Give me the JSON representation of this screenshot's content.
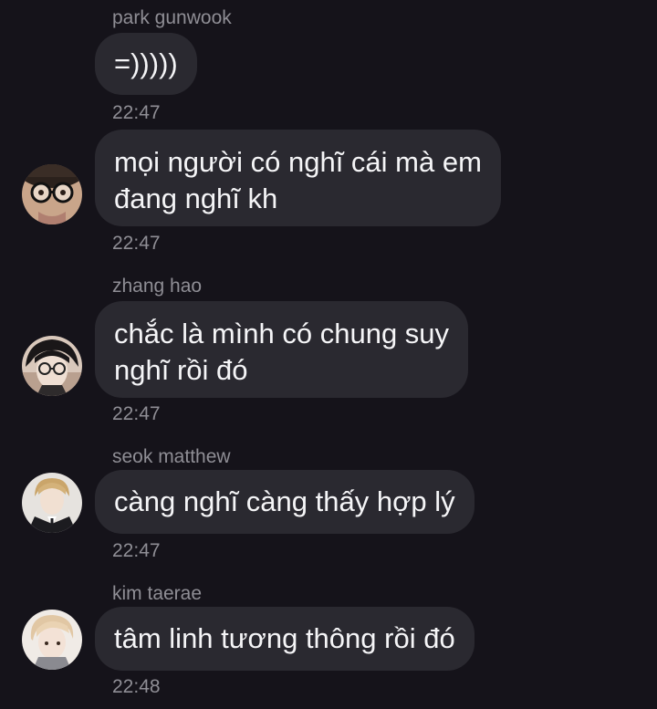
{
  "messages": [
    {
      "sender": "park gunwook",
      "lines": [
        "=)))))"
      ],
      "time": "22:47",
      "avatar": null
    },
    {
      "sender": "",
      "lines": [
        "mọi người có nghĩ cái mà em",
        "đang nghĩ kh"
      ],
      "time": "22:47",
      "avatar": "avatar-glasses-icon"
    },
    {
      "sender": "zhang hao",
      "lines": [
        "chắc là mình có chung suy",
        "nghĩ rồi đó"
      ],
      "time": "22:47",
      "avatar": "avatar-dark-hair-glasses-icon"
    },
    {
      "sender": "seok matthew",
      "lines": [
        "càng nghĩ càng thấy hợp lý"
      ],
      "time": "22:47",
      "avatar": "avatar-suit-icon"
    },
    {
      "sender": "kim taerae",
      "lines": [
        "tâm linh tương thông rồi đó"
      ],
      "time": "22:48",
      "avatar": "avatar-blond-hair-icon"
    }
  ],
  "colors": {
    "background": "#15131a",
    "bubble": "#2a2930",
    "meta_text": "#8f8e95",
    "message_text": "#f5f5f7"
  }
}
